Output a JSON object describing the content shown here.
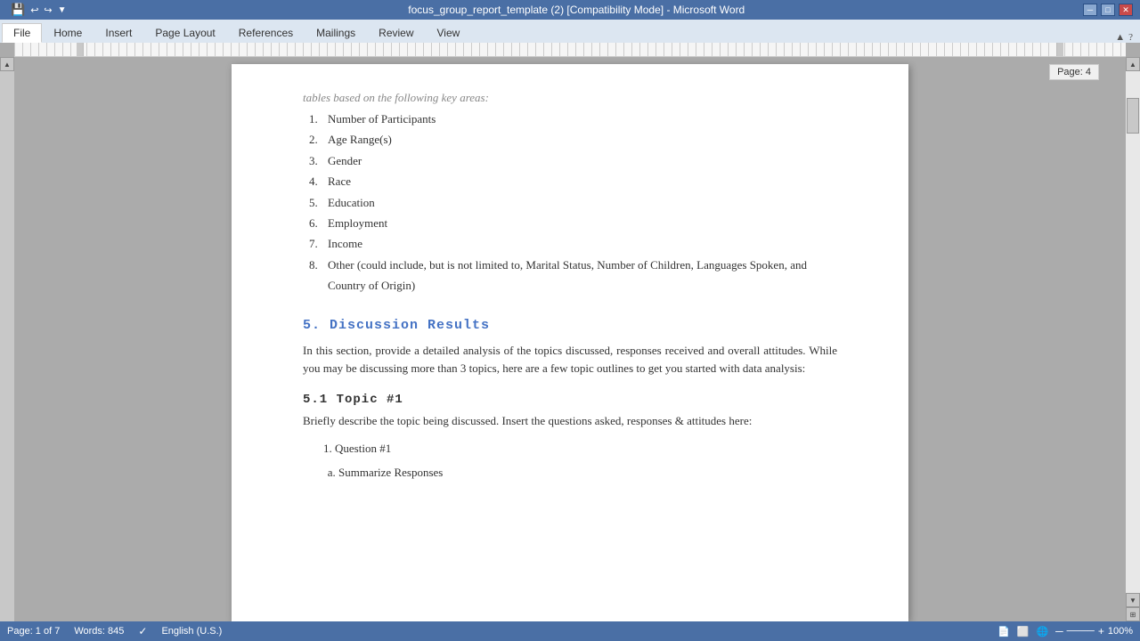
{
  "titlebar": {
    "title": "focus_group_report_template (2) [Compatibility Mode] - Microsoft Word",
    "minimize": "─",
    "maximize": "□",
    "close": "✕"
  },
  "quickaccess": {
    "buttons": [
      "💾",
      "↩",
      "↪"
    ]
  },
  "ribbon": {
    "active_tab": "File",
    "tabs": [
      "File",
      "Home",
      "Insert",
      "Page Layout",
      "References",
      "Mailings",
      "Review",
      "View"
    ]
  },
  "page_indicator": "Page: 4",
  "document": {
    "top_text": "tables based on the following key areas:",
    "list_items": [
      "Number of Participants",
      "Age Range(s)",
      "Gender",
      "Race",
      "Education",
      "Employment",
      "Income",
      "Other (could include, but is not limited to, Marital Status, Number of Children, Languages Spoken, and Country of Origin)"
    ],
    "section5_heading": "5. Discussion Results",
    "section5_paragraph": "In this section, provide a detailed analysis of the topics discussed, responses received and overall attitudes.  While you may be discussing more than 3 topics, here are a few topic outlines to get you started with data analysis:",
    "sub51_heading": "5.1 Topic #1",
    "sub51_paragraph": "Briefly describe the topic being discussed.   Insert the questions asked, responses & attitudes here:",
    "sub_list": [
      "Question #1"
    ],
    "sub_sub_list": [
      "Summarize Responses"
    ]
  },
  "statusbar": {
    "page": "Page: 1 of 7",
    "words": "Words: 845",
    "language": "English (U.S.)",
    "zoom": "100%"
  }
}
